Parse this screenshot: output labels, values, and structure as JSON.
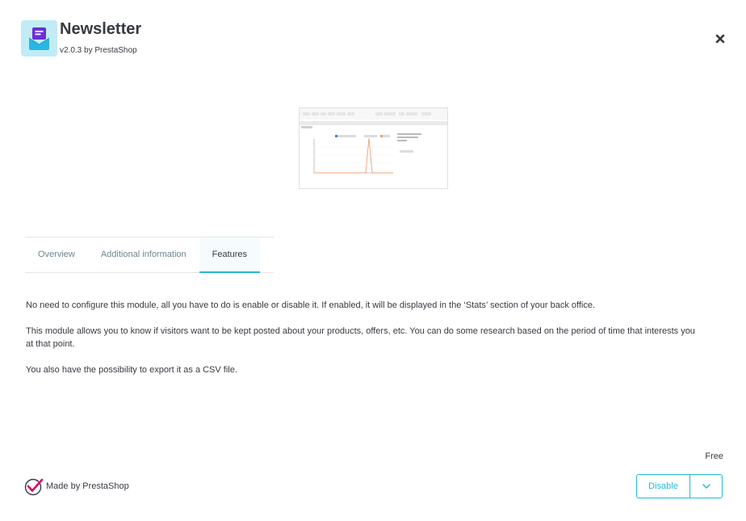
{
  "module": {
    "title": "Newsletter",
    "version_line": "v2.0.3 by PrestaShop",
    "logo_icon": "envelope-icon"
  },
  "close_icon": "close-icon",
  "tabs": [
    {
      "label": "Overview",
      "active": false
    },
    {
      "label": "Additional information",
      "active": false
    },
    {
      "label": "Features",
      "active": true
    }
  ],
  "content": {
    "paragraphs": [
      "No need to configure this module, all you have to do is enable or disable it. If enabled, it will be displayed in the ‘Stats’ section of your back office.",
      "This module allows you to know if visitors want to be kept posted about your products, offers, etc. You can do some research based on the period of time that interests you at that point.",
      "You also have the possibility to export it as a CSV file."
    ]
  },
  "price": "Free",
  "footer": {
    "made_by": "Made by PrestaShop"
  },
  "actions": {
    "disable_label": "Disable"
  },
  "colors": {
    "accent": "#25b9d7",
    "logo_bg": "#c2ecf5",
    "logo_purple": "#6a2fd8",
    "logo_cyan": "#29b6e3",
    "made_by_red": "#df0067"
  }
}
